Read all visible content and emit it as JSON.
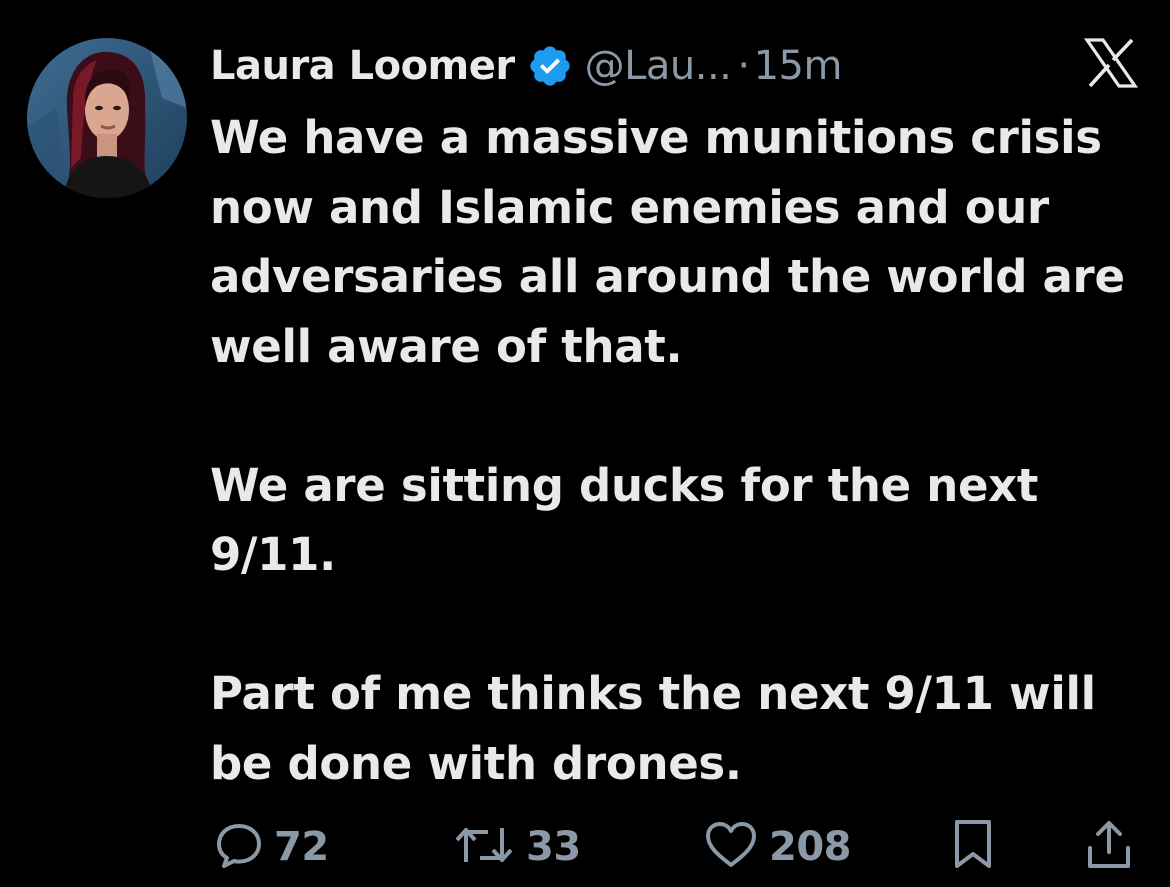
{
  "author": {
    "name": "Laura Loomer",
    "handle": "@Lau...",
    "separator": "·",
    "time": "15m",
    "verified": true
  },
  "tweet": {
    "paragraphs": [
      "We have a massive munitions crisis now and Islamic enemies and our adversaries all around the world are well aware of that.",
      "We are sitting ducks for the next 9/11.",
      "Part of me thinks the next 9/11 will be done with drones."
    ]
  },
  "actions": {
    "replies": "72",
    "reposts": "33",
    "likes": "208"
  },
  "icons": {
    "verified": "verified-badge-icon",
    "platform": "x-logo-icon",
    "reply": "reply-bubble-icon",
    "repost": "repost-arrows-icon",
    "like": "heart-icon",
    "bookmark": "bookmark-icon",
    "share": "share-icon"
  },
  "colors": {
    "background": "#000000",
    "text": "#e7e9ea",
    "secondary_text": "#8b98a5",
    "verified_blue": "#1d9bf0"
  }
}
